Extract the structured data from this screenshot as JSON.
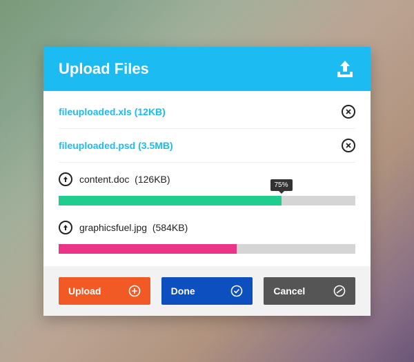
{
  "header": {
    "title": "Upload Files"
  },
  "files": {
    "uploaded": [
      {
        "name": "fileuploaded.xls",
        "size": "12KB"
      },
      {
        "name": "fileuploaded.psd",
        "size": "3.5MB"
      }
    ],
    "uploading": [
      {
        "name": "content.doc",
        "size": "126KB",
        "progress": 75,
        "tooltip": "75%",
        "color": "green"
      },
      {
        "name": "graphicsfuel.jpg",
        "size": "584KB",
        "progress": 60,
        "tooltip": "",
        "color": "pink"
      }
    ]
  },
  "buttons": {
    "upload": "Upload",
    "done": "Done",
    "cancel": "Cancel"
  }
}
